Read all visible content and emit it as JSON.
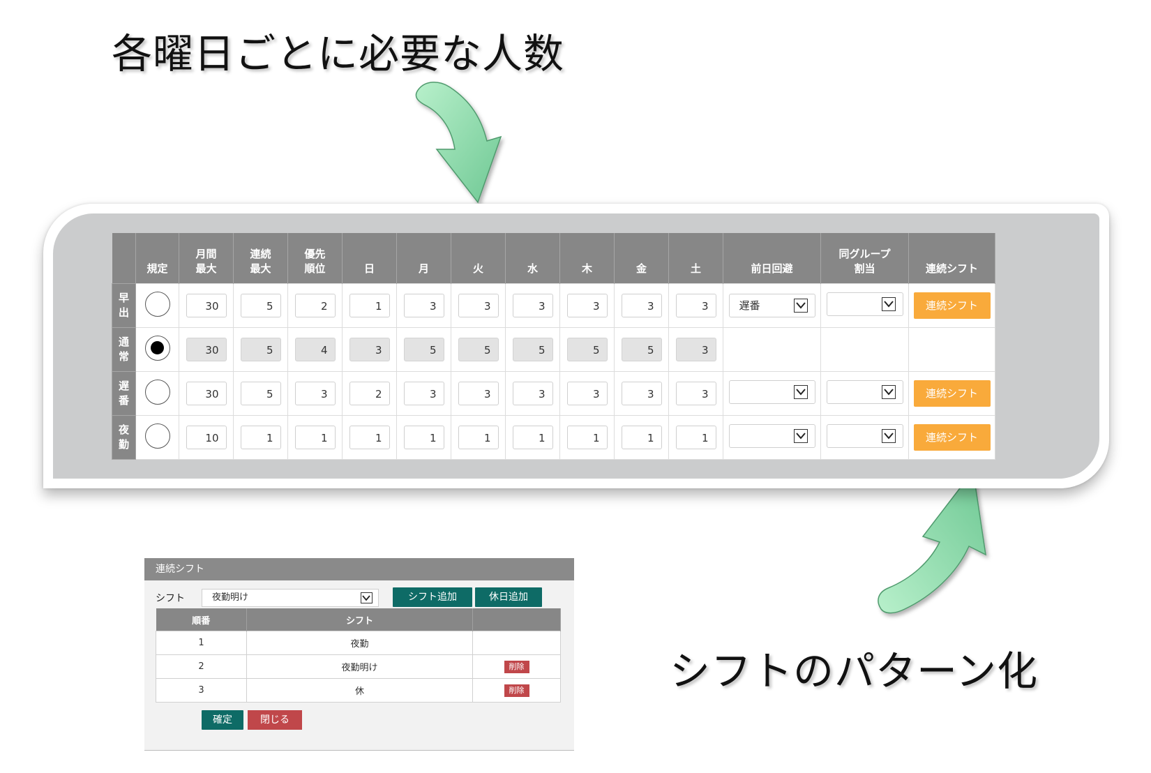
{
  "captions": {
    "top": "各曜日ごとに必要な人数",
    "bottom": "シフトのパターン化"
  },
  "colors": {
    "arrow": "#8fdcae",
    "header_gray": "#878787",
    "panel_gray": "#cbcccd",
    "orange": "#f9aa3b",
    "teal": "#0e6b66",
    "red": "#c0474a"
  },
  "shift_table": {
    "headers": {
      "default": "規定",
      "monthly_max_1": "月間",
      "monthly_max_2": "最大",
      "consecutive_max_1": "連続",
      "consecutive_max_2": "最大",
      "priority_1": "優先",
      "priority_2": "順位",
      "sun": "日",
      "mon": "月",
      "tue": "火",
      "wed": "水",
      "thu": "木",
      "fri": "金",
      "sat": "土",
      "prev_day_avoid": "前日回避",
      "same_group_1": "同グループ",
      "same_group_2": "割当",
      "consecutive_shift": "連続シフト"
    },
    "rows": [
      {
        "label_1": "早",
        "label_2": "出",
        "checked": false,
        "monthly_max": "30",
        "consecutive_max": "5",
        "priority": "2",
        "days": [
          "1",
          "3",
          "3",
          "3",
          "3",
          "3",
          "3"
        ],
        "prev_day_avoid": "遅番",
        "same_group": "",
        "button": "連続シフト"
      },
      {
        "label_1": "通",
        "label_2": "常",
        "checked": true,
        "monthly_max": "30",
        "consecutive_max": "5",
        "priority": "4",
        "days": [
          "3",
          "5",
          "5",
          "5",
          "5",
          "5",
          "3"
        ]
      },
      {
        "label_1": "遅",
        "label_2": "番",
        "checked": false,
        "monthly_max": "30",
        "consecutive_max": "5",
        "priority": "3",
        "days": [
          "2",
          "3",
          "3",
          "3",
          "3",
          "3",
          "3"
        ],
        "prev_day_avoid": "",
        "same_group": "",
        "button": "連続シフト"
      },
      {
        "label_1": "夜",
        "label_2": "勤",
        "checked": false,
        "monthly_max": "10",
        "consecutive_max": "1",
        "priority": "1",
        "days": [
          "1",
          "1",
          "1",
          "1",
          "1",
          "1",
          "1"
        ],
        "prev_day_avoid": "",
        "same_group": "",
        "button": "連続シフト"
      }
    ]
  },
  "dialog": {
    "title": "連続シフト",
    "shift_label": "シフト",
    "shift_selected": "夜勤明け",
    "add_shift_button": "シフト追加",
    "add_holiday_button": "休日追加",
    "columns": {
      "order": "順番",
      "shift": "シフト",
      "action": ""
    },
    "rows": [
      {
        "order": "1",
        "shift": "夜勤",
        "delete": ""
      },
      {
        "order": "2",
        "shift": "夜勤明け",
        "delete": "削除"
      },
      {
        "order": "3",
        "shift": "休",
        "delete": "削除"
      }
    ],
    "confirm_button": "確定",
    "close_button": "閉じる"
  }
}
